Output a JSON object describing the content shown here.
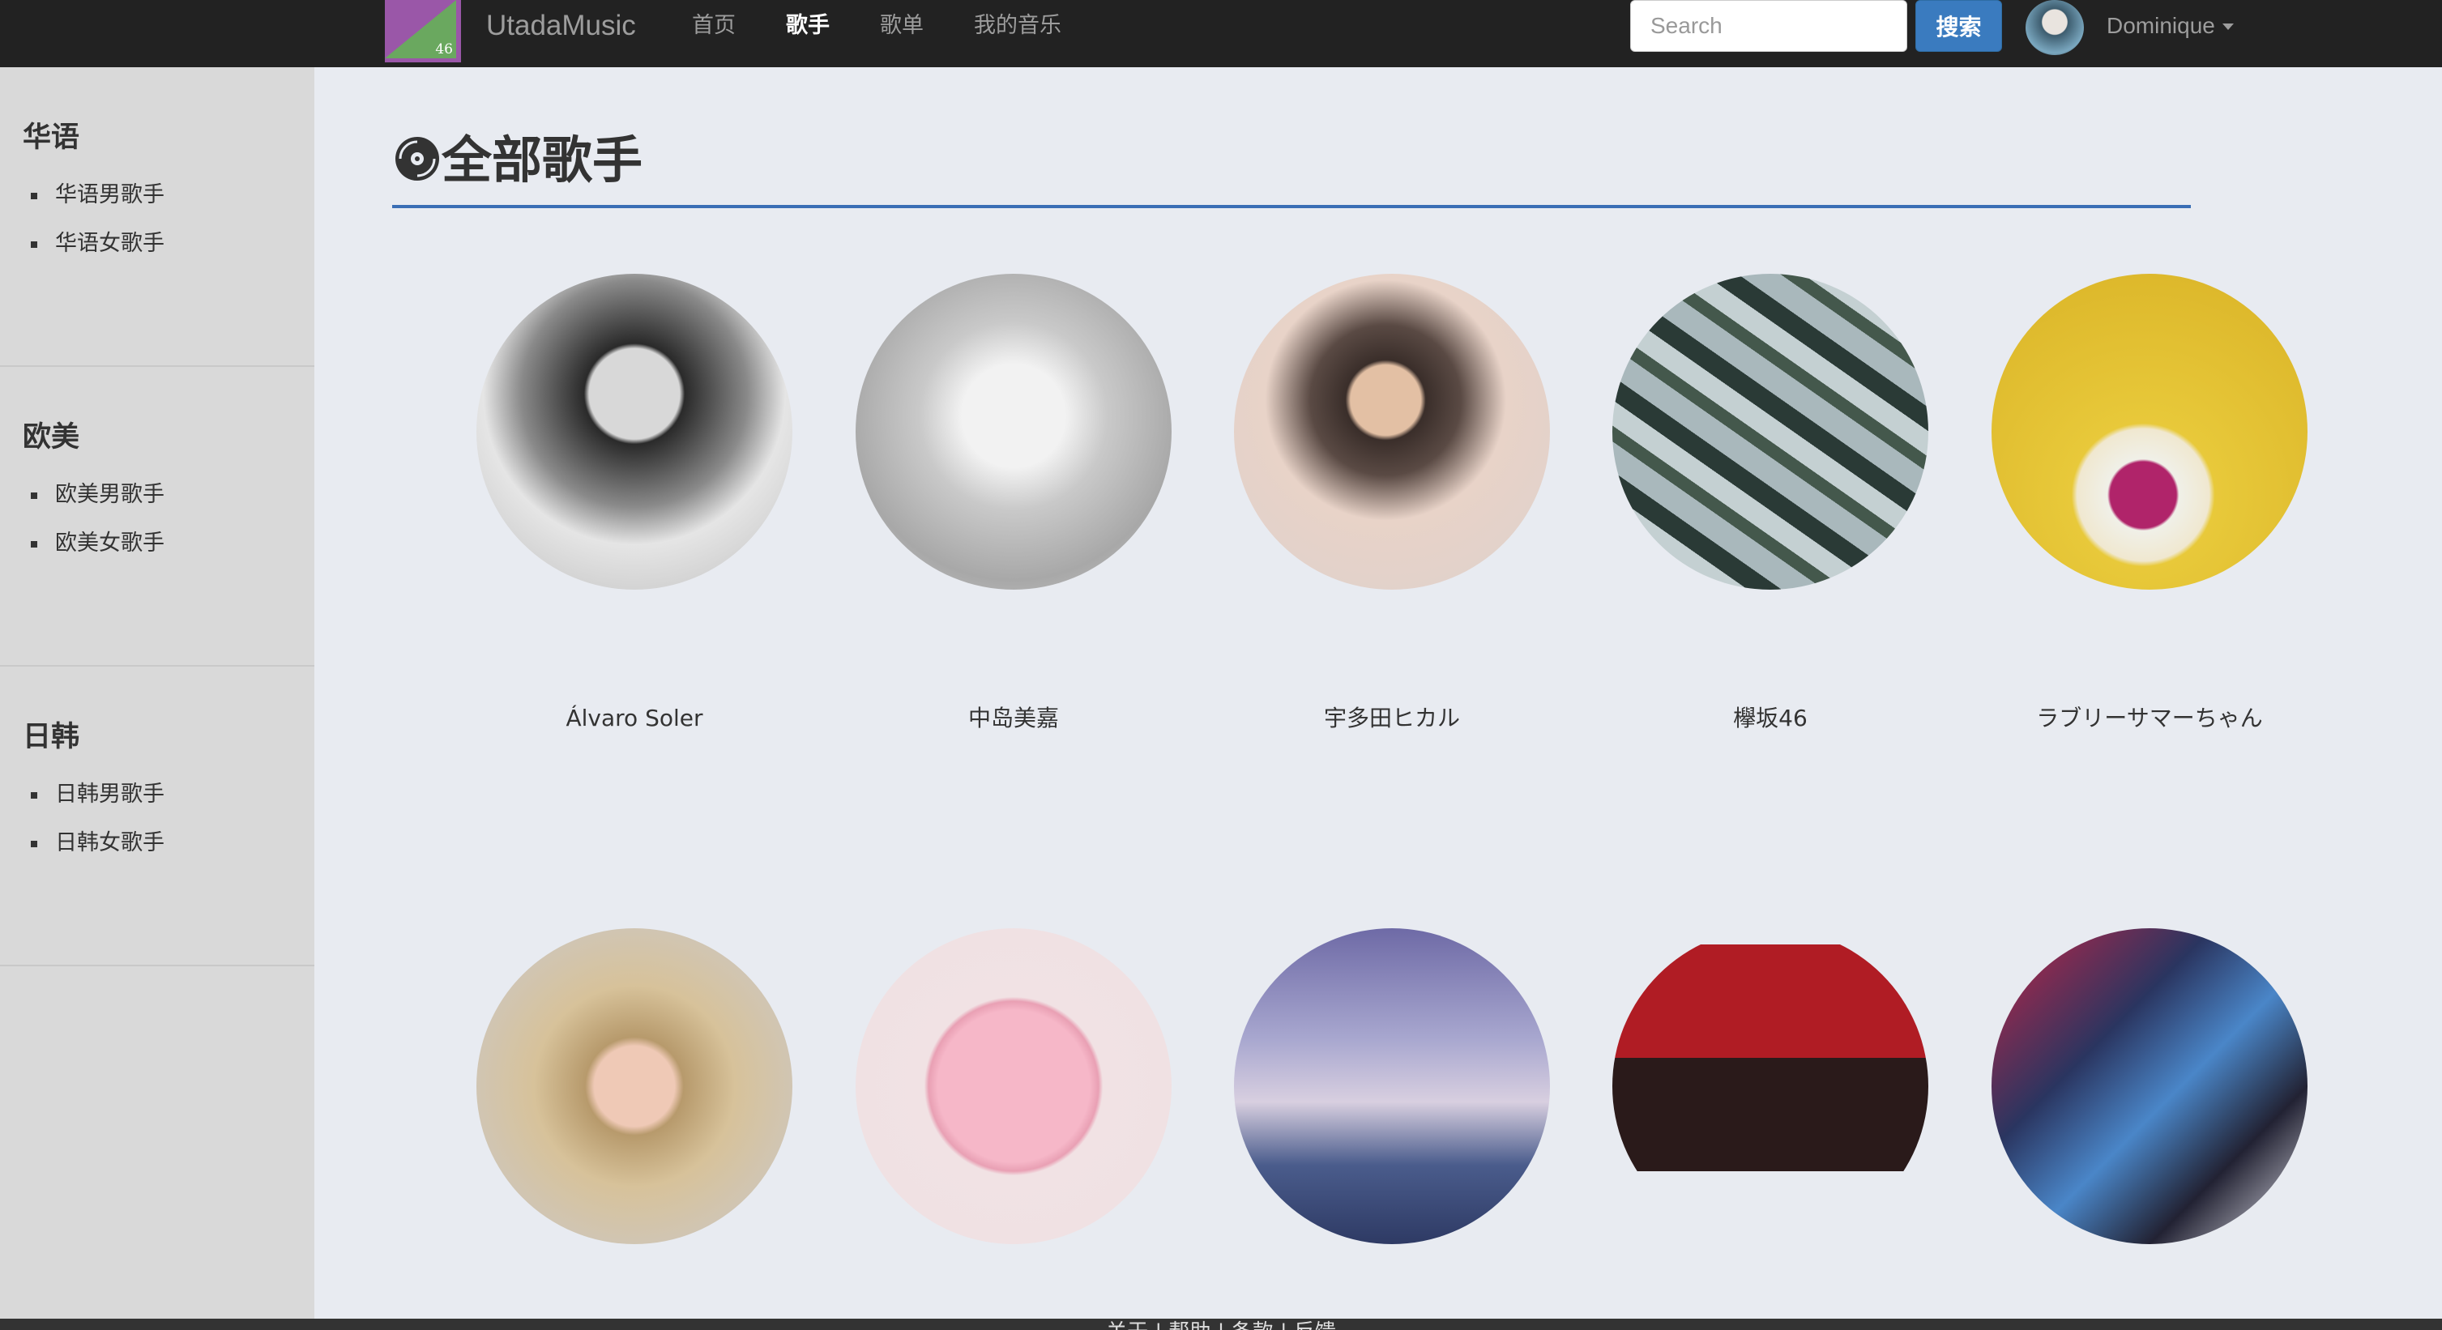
{
  "navbar": {
    "logo_number": "46",
    "brand": "UtadaMusic",
    "items": [
      {
        "label": "首页",
        "active": false
      },
      {
        "label": "歌手",
        "active": true
      },
      {
        "label": "歌单",
        "active": false
      },
      {
        "label": "我的音乐",
        "active": false
      }
    ],
    "search_placeholder": "Search",
    "search_button": "搜索",
    "user_name": "Dominique"
  },
  "sidebar": {
    "sections": [
      {
        "heading": "华语",
        "items": [
          "华语男歌手",
          "华语女歌手"
        ]
      },
      {
        "heading": "欧美",
        "items": [
          "欧美男歌手",
          "欧美女歌手"
        ]
      },
      {
        "heading": "日韩",
        "items": [
          "日韩男歌手",
          "日韩女歌手"
        ]
      }
    ]
  },
  "main": {
    "title": "全部歌手",
    "artists": [
      {
        "name": "Álvaro Soler"
      },
      {
        "name": "中岛美嘉"
      },
      {
        "name": "宇多田ヒカル"
      },
      {
        "name": "欅坂46"
      },
      {
        "name": "ラブリーサマーちゃん"
      },
      {
        "name": ""
      },
      {
        "name": ""
      },
      {
        "name": ""
      },
      {
        "name": ""
      },
      {
        "name": ""
      }
    ]
  },
  "footer": {
    "text": "关于 | 帮助 | 条款 | 反馈"
  },
  "colors": {
    "navbar_bg": "#222222",
    "accent_blue": "#3a7bbf",
    "title_rule": "#3a6eb5",
    "sidebar_bg": "#d9d9d9",
    "page_bg": "#e8ebf1"
  }
}
